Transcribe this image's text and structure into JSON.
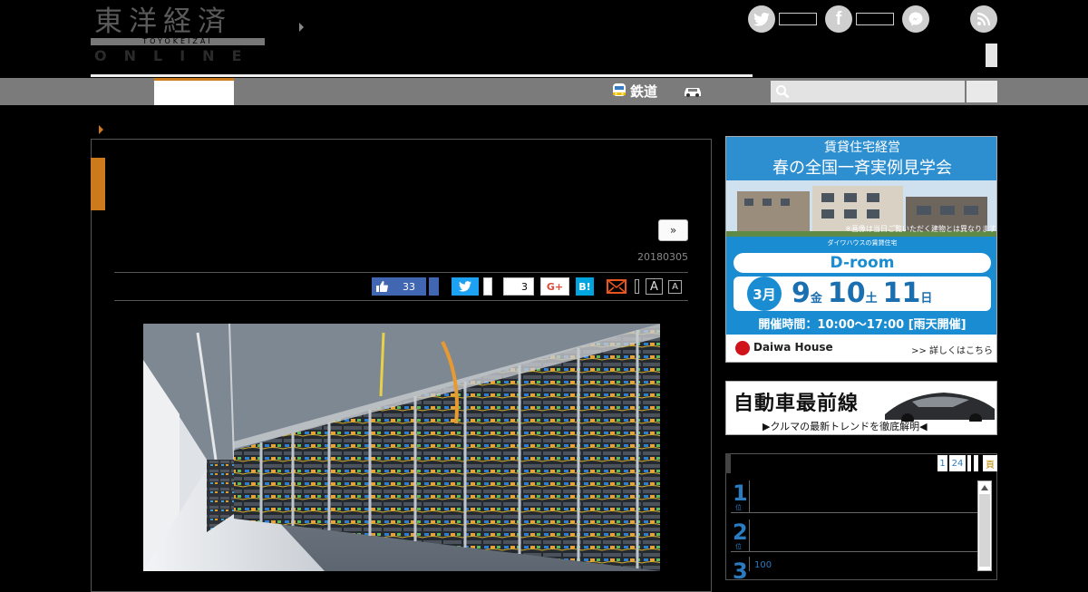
{
  "site": {
    "logo_jp": "東洋経済",
    "logo_romaji": "TOYOKEIZAI",
    "logo_en": "ONLINE"
  },
  "sns": {
    "twitter_icon": "twitter-icon",
    "facebook_icon": "facebook-icon",
    "messenger_icon": "messenger-icon",
    "rss_icon": "rss-icon"
  },
  "nav": {
    "rail_label": "鉄道",
    "rail_icon": "train-icon",
    "car_icon": "car-icon",
    "active_color": "#cc7a1b",
    "search_icon": "search-icon"
  },
  "article": {
    "next_label": "»",
    "date": "20180305",
    "like_count": "33",
    "share_count": "3",
    "gplus_label": "G+",
    "hatena_label": "B!",
    "font_large_label": "A",
    "font_small_label": "A"
  },
  "ads": {
    "droom": {
      "header_line1": "賃貸住宅経営",
      "header_line2": "春の全国一斉実例見学会",
      "photo_note": "※画像は当日ご覧いただく建物とは異なります",
      "subbrand": "ダイワハウスの賃貸住宅",
      "brand": "D-room",
      "month": "3月",
      "day1": "9",
      "dow1": "金",
      "day2": "10",
      "dow2": "土",
      "day3": "11",
      "dow3": "日",
      "hours": "開催時間：10:00〜17:00 [雨天開催]",
      "company": "Daiwa House",
      "more": ">> 詳しくはこちら"
    },
    "car": {
      "title": "自動車最前線",
      "subtitle": "▶クルマの最新トレンドを徹底解明◀"
    }
  },
  "ranking": {
    "tab_1": "1",
    "tab_24": "24",
    "tab_last": "頁",
    "items": [
      {
        "rank": "1",
        "rank_suffix": "位",
        "text": ""
      },
      {
        "rank": "2",
        "rank_suffix": "位",
        "text": ""
      },
      {
        "rank": "3",
        "rank_suffix": "",
        "text": "100"
      }
    ]
  }
}
